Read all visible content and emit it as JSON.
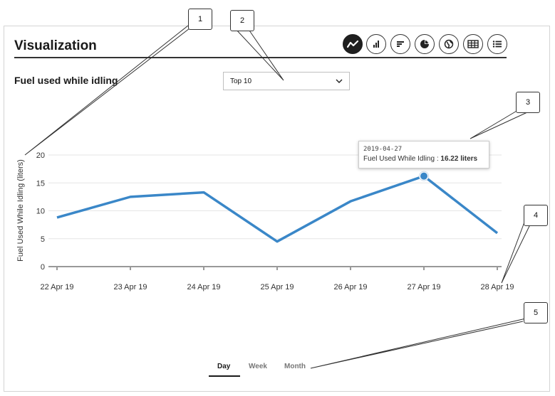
{
  "header": {
    "title": "Visualization"
  },
  "toolbar": {
    "buttons": [
      {
        "icon": "line-chart-icon",
        "active": true
      },
      {
        "icon": "bar-chart-icon",
        "active": false
      },
      {
        "icon": "horizontal-bar-icon",
        "active": false
      },
      {
        "icon": "pie-chart-icon",
        "active": false
      },
      {
        "icon": "globe-icon",
        "active": false
      },
      {
        "icon": "table-icon",
        "active": false
      },
      {
        "icon": "list-icon",
        "active": false
      }
    ]
  },
  "chart_title": "Fuel used while idling",
  "filter": {
    "selected": "Top 10"
  },
  "chart_data": {
    "type": "line",
    "x": [
      "22 Apr 19",
      "23 Apr 19",
      "24 Apr 19",
      "25 Apr 19",
      "26 Apr 19",
      "27 Apr 19",
      "28 Apr 19"
    ],
    "series": [
      {
        "values": [
          8.8,
          12.5,
          13.3,
          4.5,
          11.7,
          16.22,
          6.0
        ]
      }
    ],
    "ylabel": "Fuel Used While Idling (liters)",
    "ylim": [
      0,
      20
    ],
    "yticks": [
      0,
      5,
      10,
      15,
      20
    ],
    "grid": true,
    "color": "#3a87c8"
  },
  "tooltip": {
    "date": "2019-04-27",
    "label": "Fuel Used While Idling : ",
    "value": "16.22 liters"
  },
  "periods": [
    {
      "label": "Day",
      "active": true
    },
    {
      "label": "Week",
      "active": false
    },
    {
      "label": "Month",
      "active": false
    }
  ],
  "callouts": [
    "1",
    "2",
    "3",
    "4",
    "5"
  ]
}
